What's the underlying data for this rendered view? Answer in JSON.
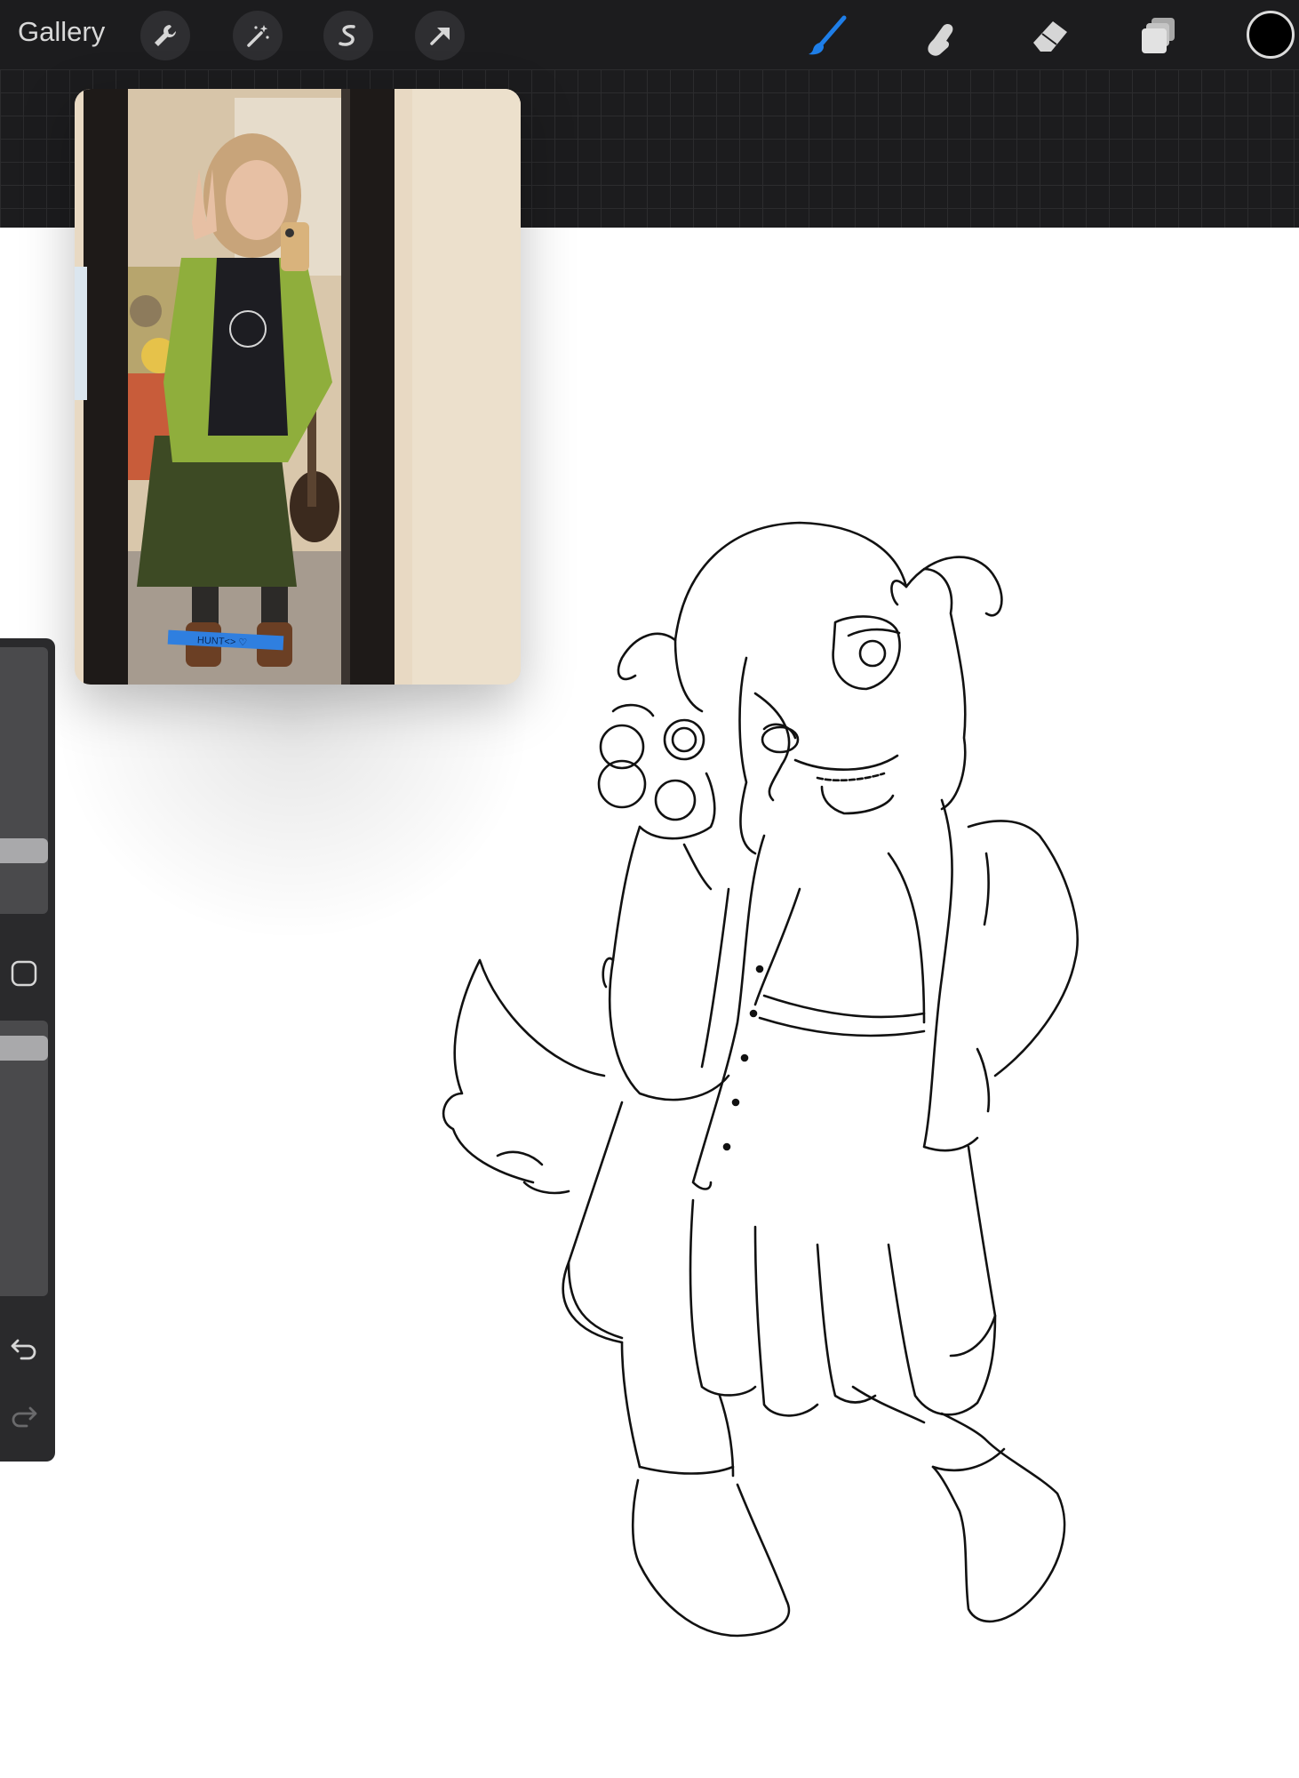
{
  "app": {
    "gallery_label": "Gallery"
  },
  "toolbar": {
    "left_tools": [
      "wrench-icon",
      "magic-wand-icon",
      "selection-s-icon",
      "transform-arrow-icon"
    ],
    "right_tools": [
      "brush-icon",
      "smudge-icon",
      "eraser-icon",
      "layers-icon"
    ],
    "active_tool": "brush",
    "brush_color": "#1e7ee8",
    "current_color": "#000000"
  },
  "reference": {
    "tape_text": "HUNT<> ♡"
  },
  "sidebar": {
    "brush_size_level": 0.21,
    "opacity_level": 0.06,
    "modify_button": "square-icon",
    "undo": "undo-icon",
    "redo": "redo-icon"
  },
  "colors": {
    "toolbar_bg": "#1c1c1e",
    "canvas_bg": "#ffffff",
    "line_color": "#111111"
  }
}
